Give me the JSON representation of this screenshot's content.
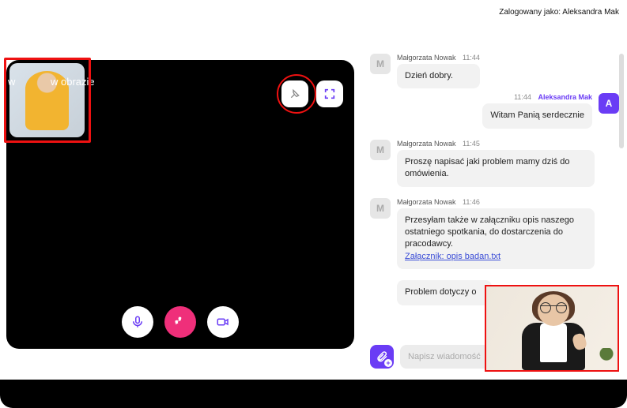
{
  "login_bar": {
    "prefix": "Zalogowany jako:",
    "user": "Aleksandra Mak"
  },
  "video": {
    "pip_label": "w obrazie",
    "pip_left": "w"
  },
  "chat": {
    "messages": [
      {
        "side": "left",
        "avatar": "M",
        "name": "Małgorzata Nowak",
        "time": "11:44",
        "text": "Dzień dobry."
      },
      {
        "side": "right",
        "avatar": "A",
        "name": "Aleksandra Mak",
        "time": "11:44",
        "text": "Witam Panią serdecznie"
      },
      {
        "side": "left",
        "avatar": "M",
        "name": "Małgorzata Nowak",
        "time": "11:45",
        "text": "Proszę napisać jaki problem mamy dziś do omówienia."
      },
      {
        "side": "left",
        "avatar": "M",
        "name": "Małgorzata Nowak",
        "time": "11:46",
        "text": "Przesyłam także w załączniku opis naszego ostatniego spotkania, do dostarczenia do pracodawcy.",
        "attachment": "Załącznik: opis badan.txt"
      },
      {
        "side": "left",
        "avatar": "",
        "name": "",
        "time": "",
        "text": "Problem dotyczy o",
        "partial": true
      }
    ],
    "composer_placeholder": "Napisz wiadomość"
  }
}
